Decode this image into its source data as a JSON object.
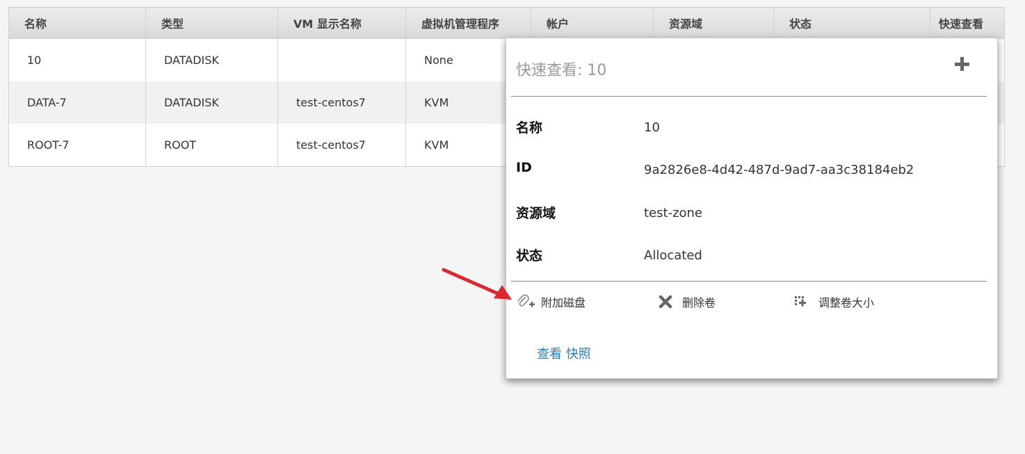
{
  "table": {
    "columns": [
      "名称",
      "类型",
      "VM 显示名称",
      "虚拟机管理程序",
      "帐户",
      "资源域",
      "状态",
      "快速查看"
    ],
    "rows": [
      {
        "name": "10",
        "type": "DATADISK",
        "vm": "",
        "hypervisor": "None"
      },
      {
        "name": "DATA-7",
        "type": "DATADISK",
        "vm": "test-centos7",
        "hypervisor": "KVM"
      },
      {
        "name": "ROOT-7",
        "type": "ROOT",
        "vm": "test-centos7",
        "hypervisor": "KVM"
      }
    ]
  },
  "quickview": {
    "title": "快速查看: 10",
    "fields": [
      {
        "label": "名称",
        "value": "10"
      },
      {
        "label": "ID",
        "value": "9a2826e8-4d42-487d-9ad7-aa3c38184eb2"
      },
      {
        "label": "资源域",
        "value": "test-zone"
      },
      {
        "label": "状态",
        "value": "Allocated"
      }
    ],
    "actions": [
      {
        "label": "附加磁盘",
        "icon": "paperclip-plus-icon"
      },
      {
        "label": "删除卷",
        "icon": "x-icon"
      },
      {
        "label": "调整卷大小",
        "icon": "resize-icon"
      }
    ],
    "link": "查看 快照"
  },
  "colors": {
    "link": "#2d7bb6",
    "annotation_arrow": "#e0262b",
    "header_bg": "#dedede"
  }
}
